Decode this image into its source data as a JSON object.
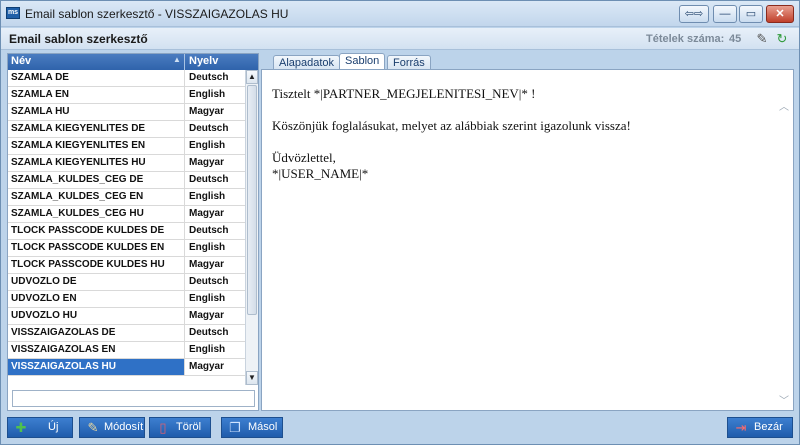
{
  "window": {
    "title": "Email sablon szerkesztő - VISSZAIGAZOLAS HU",
    "app_icon_text": "ms",
    "controls": {
      "back": "⇦⇨",
      "minimize": "—",
      "maximize": "▭",
      "close": "✕"
    }
  },
  "header": {
    "title": "Email sablon szerkesztő",
    "count_label": "Tételek száma:",
    "count_value": "45",
    "icons": [
      "eraser-icon",
      "refresh-icon"
    ]
  },
  "grid": {
    "columns": {
      "name": "Név",
      "language": "Nyelv"
    },
    "rows": [
      {
        "name": "SZAMLA DE",
        "language": "Deutsch"
      },
      {
        "name": "SZAMLA EN",
        "language": "English"
      },
      {
        "name": "SZAMLA HU",
        "language": "Magyar"
      },
      {
        "name": "SZAMLA KIEGYENLITES DE",
        "language": "Deutsch"
      },
      {
        "name": "SZAMLA KIEGYENLITES EN",
        "language": "English"
      },
      {
        "name": "SZAMLA KIEGYENLITES HU",
        "language": "Magyar"
      },
      {
        "name": "SZAMLA_KULDES_CEG DE",
        "language": "Deutsch"
      },
      {
        "name": "SZAMLA_KULDES_CEG EN",
        "language": "English"
      },
      {
        "name": "SZAMLA_KULDES_CEG HU",
        "language": "Magyar"
      },
      {
        "name": "TLOCK PASSCODE KULDES DE",
        "language": "Deutsch"
      },
      {
        "name": "TLOCK PASSCODE KULDES EN",
        "language": "English"
      },
      {
        "name": "TLOCK PASSCODE KULDES HU",
        "language": "Magyar"
      },
      {
        "name": "UDVOZLO DE",
        "language": "Deutsch"
      },
      {
        "name": "UDVOZLO EN",
        "language": "English"
      },
      {
        "name": "UDVOZLO HU",
        "language": "Magyar"
      },
      {
        "name": "VISSZAIGAZOLAS DE",
        "language": "Deutsch"
      },
      {
        "name": "VISSZAIGAZOLAS EN",
        "language": "English"
      },
      {
        "name": "VISSZAIGAZOLAS HU",
        "language": "Magyar",
        "selected": true
      }
    ],
    "filter_value": ""
  },
  "tabs": [
    {
      "label": "Alapadatok",
      "active": false
    },
    {
      "label": "Sablon",
      "active": true
    },
    {
      "label": "Forrás",
      "active": false
    }
  ],
  "editor": {
    "line1": "Tisztelt *|PARTNER_MEGJELENITESI_NEV|* !",
    "line2": "Köszönjük foglalásukat, melyet az alábbiak szerint igazolunk vissza!",
    "line3": "Üdvözlettel,",
    "line4": "*|USER_NAME|*"
  },
  "buttons": {
    "new": "Új",
    "modify": "Módosít",
    "delete": "Töröl",
    "copy": "Másol",
    "close": "Bezár"
  },
  "colors": {
    "accent": "#2f71c6",
    "header_blue": "#2f63ab",
    "button_blue": "#1f5cab"
  }
}
